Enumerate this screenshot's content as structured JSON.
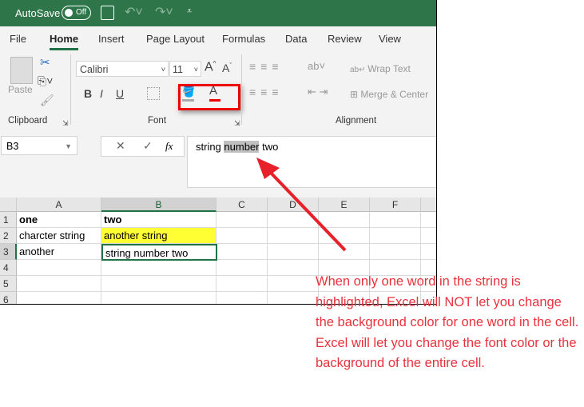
{
  "title_bar": {
    "autosave_label": "AutoSave",
    "autosave_state": "Off"
  },
  "tabs": [
    "File",
    "Home",
    "Insert",
    "Page Layout",
    "Formulas",
    "Data",
    "Review",
    "View"
  ],
  "ribbon": {
    "clipboard": {
      "paste": "Paste",
      "group": "Clipboard"
    },
    "font": {
      "font_name": "Calibri",
      "font_size": "11",
      "bold": "B",
      "italic": "I",
      "underline": "U",
      "font_color": "A",
      "group": "Font"
    },
    "alignment": {
      "wrap_text": "Wrap Text",
      "merge": "Merge & Center",
      "group": "Alignment"
    }
  },
  "formula_bar": {
    "name_box": "B3",
    "fx": "fx",
    "text_before": "string ",
    "text_selected": "number",
    "text_after": " two"
  },
  "sheet": {
    "columns": [
      "A",
      "B",
      "C",
      "D",
      "E",
      "F"
    ],
    "rows": [
      "1",
      "2",
      "3",
      "4",
      "5",
      "6"
    ],
    "cells": {
      "A1": "one",
      "B1": "two",
      "A2": "charcter string",
      "B2": "another string",
      "A3": "another",
      "B3": "string number two"
    },
    "highlight_color": "#ffff33"
  },
  "annotation": "When only one word in the string is highlighted, Excel will NOT let you change the background color for one word in the cell. Excel will let you change the font color or the background of the entire cell."
}
